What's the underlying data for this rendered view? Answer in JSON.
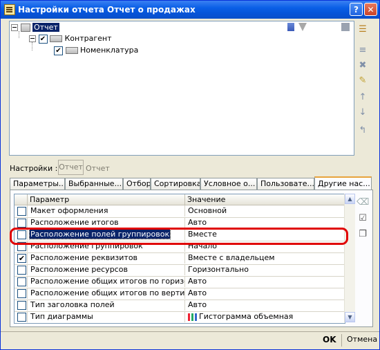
{
  "window": {
    "title": "Настройки отчета  Отчет о продажах",
    "help_label": "?",
    "close_label": "✕"
  },
  "tree": {
    "root_label": "Отчет",
    "child_label": "Контрагент",
    "grandchild_label": "Номенклатура"
  },
  "settings": {
    "label": "Настройки :",
    "box_value": "Отчет",
    "value_text": "Отчет"
  },
  "tabs": [
    {
      "label": "Параметры..."
    },
    {
      "label": "Выбранные..."
    },
    {
      "label": "Отбор"
    },
    {
      "label": "Сортировка"
    },
    {
      "label": "Условное о..."
    },
    {
      "label": "Пользовате..."
    },
    {
      "label": "Другие нас..."
    }
  ],
  "grid": {
    "col_param": "Параметр",
    "col_value": "Значение",
    "rows": [
      {
        "checked": false,
        "param": "Макет оформления",
        "value": "Основной"
      },
      {
        "checked": false,
        "param": "Расположение итогов",
        "value": "Авто"
      },
      {
        "checked": false,
        "param": "Расположение полей группировок",
        "value": "Вместе"
      },
      {
        "checked": false,
        "param": "Расположение группировок",
        "value": "Начало"
      },
      {
        "checked": true,
        "param": "Расположение реквизитов",
        "value": "Вместе с владельцем"
      },
      {
        "checked": false,
        "param": "Расположение ресурсов",
        "value": "Горизонтально"
      },
      {
        "checked": false,
        "param": "Расположение общих итогов по горизонтали",
        "value": "Авто"
      },
      {
        "checked": false,
        "param": "Расположение общих итогов по вертикали",
        "value": "Авто"
      },
      {
        "checked": false,
        "param": "Тип заголовка полей",
        "value": "Авто"
      },
      {
        "checked": false,
        "param": "Тип диаграммы",
        "value": "Гистограмма объемная"
      }
    ]
  },
  "footer": {
    "ok_label": "OK",
    "cancel_label": "Отмена"
  },
  "colors": {
    "title_bar": "#0a5fe6",
    "selection": "#0a246a",
    "highlight_frame": "#e00000",
    "active_tab": "#e8a33c"
  }
}
